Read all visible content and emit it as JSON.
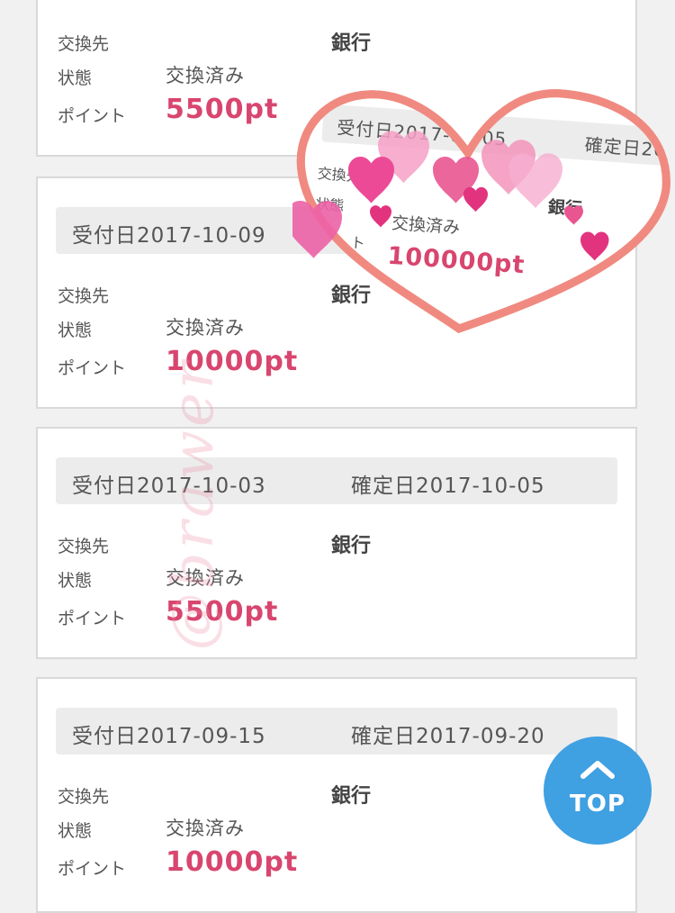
{
  "labels": {
    "destination": "交換先",
    "status": "状態",
    "points": "ポイント"
  },
  "records": [
    {
      "received": "",
      "confirmed": "",
      "destination": "銀行",
      "status": "交換済み",
      "points": "5500pt"
    },
    {
      "received": "受付日2017-10-09",
      "confirmed": "",
      "destination": "銀行",
      "status": "交換済み",
      "points": "10000pt"
    },
    {
      "received": "受付日2017-10-03",
      "confirmed": "確定日2017-10-05",
      "destination": "銀行",
      "status": "交換済み",
      "points": "5500pt"
    },
    {
      "received": "受付日2017-09-15",
      "confirmed": "確定日2017-09-20",
      "destination": "銀行",
      "status": "交換済み",
      "points": "10000pt"
    }
  ],
  "highlight": {
    "received": "受付日2017-07-05",
    "confirmed": "確定日20",
    "dest_label": "交換先",
    "status_label": "状態",
    "points_label": "ト",
    "destination": "銀行",
    "status": "交換済み",
    "points": "100000pt"
  },
  "watermark": "@brawer",
  "top_button": {
    "label": "TOP"
  },
  "colors": {
    "points": "#d8466f",
    "top_button": "#3fa0e2",
    "heart_outline": "#f08a80",
    "hearts": "#ec4a96"
  },
  "icons": {
    "top_button_icon": "chevron-up-icon",
    "decoration": "heart-icon"
  }
}
